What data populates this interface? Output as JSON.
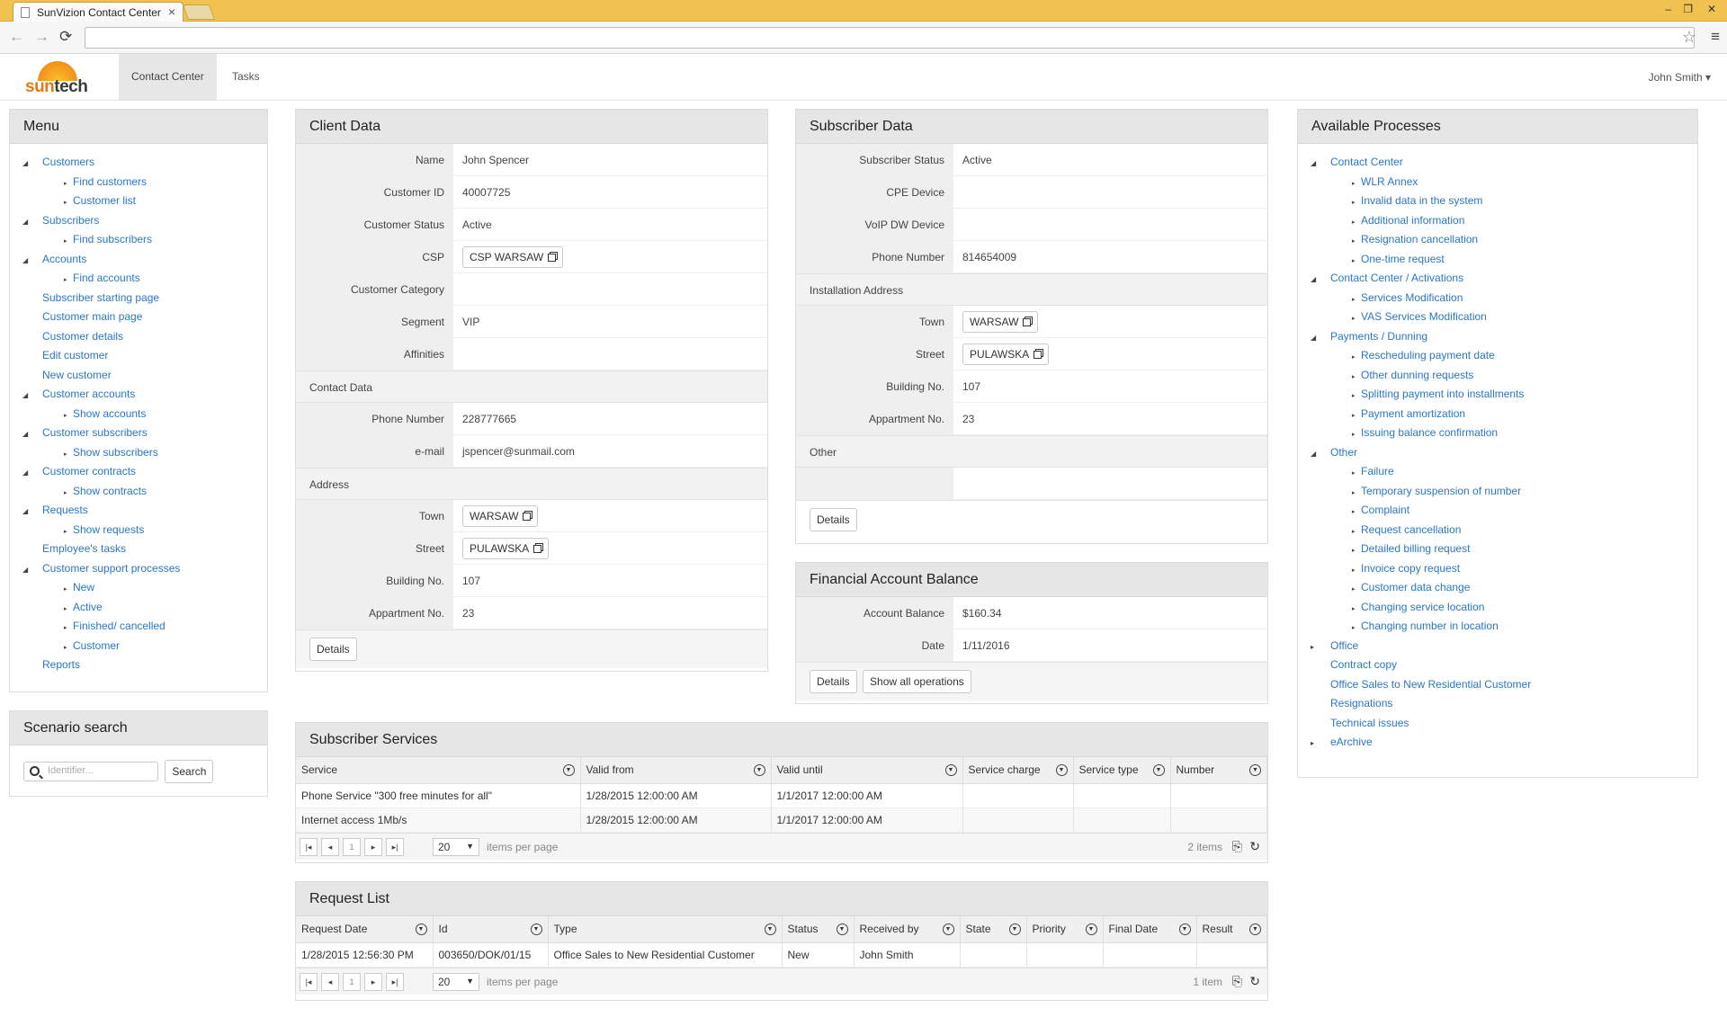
{
  "browser": {
    "tab_title": "SunVizion Contact Center",
    "tab_close": "×",
    "win_min": "–",
    "win_max": "❐",
    "win_close": "✕",
    "back": "←",
    "forward": "→",
    "reload": "⟳",
    "star": "☆",
    "menu": "≡"
  },
  "app": {
    "logo_sun": "sun",
    "logo_tech": "tech",
    "tabs": [
      "Contact Center",
      "Tasks"
    ],
    "user": "John Smith ▾"
  },
  "menu": {
    "title": "Menu",
    "items": [
      {
        "level": 1,
        "label": "Customers",
        "arrow": "◢"
      },
      {
        "level": 2,
        "label": "Find customers"
      },
      {
        "level": 2,
        "label": "Customer list"
      },
      {
        "level": 1,
        "label": "Subscribers",
        "arrow": "◢"
      },
      {
        "level": 2,
        "label": "Find subscribers"
      },
      {
        "level": 1,
        "label": "Accounts",
        "arrow": "◢"
      },
      {
        "level": 2,
        "label": "Find accounts"
      },
      {
        "level": 1,
        "label": "Subscriber starting page"
      },
      {
        "level": 1,
        "label": "Customer main page"
      },
      {
        "level": 1,
        "label": "Customer details"
      },
      {
        "level": 1,
        "label": "Edit customer"
      },
      {
        "level": 1,
        "label": "New customer"
      },
      {
        "level": 1,
        "label": "Customer accounts",
        "arrow": "◢"
      },
      {
        "level": 2,
        "label": "Show accounts"
      },
      {
        "level": 1,
        "label": "Customer subscribers",
        "arrow": "◢"
      },
      {
        "level": 2,
        "label": "Show subscribers"
      },
      {
        "level": 1,
        "label": "Customer contracts",
        "arrow": "◢"
      },
      {
        "level": 2,
        "label": "Show contracts"
      },
      {
        "level": 1,
        "label": "Requests",
        "arrow": "◢"
      },
      {
        "level": 2,
        "label": "Show requests"
      },
      {
        "level": 1,
        "label": "Employee's tasks"
      },
      {
        "level": 1,
        "label": "Customer support processes",
        "arrow": "◢"
      },
      {
        "level": 2,
        "label": "New"
      },
      {
        "level": 2,
        "label": "Active"
      },
      {
        "level": 2,
        "label": "Finished/ cancelled"
      },
      {
        "level": 2,
        "label": "Customer"
      },
      {
        "level": 1,
        "label": "Reports"
      }
    ]
  },
  "scenario": {
    "title": "Scenario search",
    "placeholder": "Identifier...",
    "button": "Search"
  },
  "client": {
    "title": "Client Data",
    "rows": [
      {
        "label": "Name",
        "value": "John Spencer"
      },
      {
        "label": "Customer ID",
        "value": "40007725"
      },
      {
        "label": "Customer Status",
        "value": "Active"
      },
      {
        "label": "CSP",
        "chip": "CSP WARSAW"
      },
      {
        "label": "Customer Category",
        "value": ""
      },
      {
        "label": "Segment",
        "value": "VIP"
      },
      {
        "label": "Affinities",
        "value": ""
      }
    ],
    "contact_title": "Contact Data",
    "contact_rows": [
      {
        "label": "Phone Number",
        "value": "228777665"
      },
      {
        "label": "e-mail",
        "value": "jspencer@sunmail.com"
      }
    ],
    "address_title": "Address",
    "address_rows": [
      {
        "label": "Town",
        "chip": "WARSAW"
      },
      {
        "label": "Street",
        "chip": "PULAWSKA"
      },
      {
        "label": "Building No.",
        "value": "107"
      },
      {
        "label": "Appartment No.",
        "value": "23"
      }
    ],
    "details": "Details"
  },
  "subscriber": {
    "title": "Subscriber Data",
    "rows": [
      {
        "label": "Subscriber Status",
        "value": "Active"
      },
      {
        "label": "CPE Device",
        "value": ""
      },
      {
        "label": "VoIP DW Device",
        "value": ""
      },
      {
        "label": "Phone Number",
        "value": "814654009"
      }
    ],
    "install_title": "Installation Address",
    "install_rows": [
      {
        "label": "Town",
        "chip": "WARSAW"
      },
      {
        "label": "Street",
        "chip": "PULAWSKA"
      },
      {
        "label": "Building No.",
        "value": "107"
      },
      {
        "label": "Appartment No.",
        "value": "23"
      }
    ],
    "other_title": "Other",
    "details": "Details"
  },
  "financial": {
    "title": "Financial Account Balance",
    "rows": [
      {
        "label": "Account Balance",
        "value": "$160.34"
      },
      {
        "label": "Date",
        "value": "1/11/2016"
      }
    ],
    "details": "Details",
    "show_all": "Show all operations"
  },
  "processes": {
    "title": "Available Processes",
    "items": [
      {
        "level": 1,
        "label": "Contact Center",
        "arrow": "◢"
      },
      {
        "level": 2,
        "label": "WLR Annex"
      },
      {
        "level": 2,
        "label": "Invalid data in the system"
      },
      {
        "level": 2,
        "label": "Additional information"
      },
      {
        "level": 2,
        "label": "Resignation cancellation"
      },
      {
        "level": 2,
        "label": "One-time request"
      },
      {
        "level": 1,
        "label": "Contact Center / Activations",
        "arrow": "◢"
      },
      {
        "level": 2,
        "label": "Services Modification"
      },
      {
        "level": 2,
        "label": "VAS Services Modification"
      },
      {
        "level": 1,
        "label": "Payments / Dunning",
        "arrow": "◢"
      },
      {
        "level": 2,
        "label": "Rescheduling payment date"
      },
      {
        "level": 2,
        "label": "Other dunning requests"
      },
      {
        "level": 2,
        "label": "Splitting payment into installments"
      },
      {
        "level": 2,
        "label": "Payment amortization"
      },
      {
        "level": 2,
        "label": "Issuing balance confirmation"
      },
      {
        "level": 1,
        "label": "Other",
        "arrow": "◢"
      },
      {
        "level": 2,
        "label": "Failure"
      },
      {
        "level": 2,
        "label": "Temporary suspension of number"
      },
      {
        "level": 2,
        "label": "Complaint"
      },
      {
        "level": 2,
        "label": "Request cancellation"
      },
      {
        "level": 2,
        "label": "Detailed billing request"
      },
      {
        "level": 2,
        "label": "Invoice copy request"
      },
      {
        "level": 2,
        "label": "Customer data change"
      },
      {
        "level": 2,
        "label": "Changing service location"
      },
      {
        "level": 2,
        "label": "Changing number in location"
      },
      {
        "level": 1,
        "label": "Office",
        "arrow": "▸"
      },
      {
        "level": 1,
        "label": "Contract copy"
      },
      {
        "level": 1,
        "label": "Office Sales to New Residential Customer"
      },
      {
        "level": 1,
        "label": "Resignations"
      },
      {
        "level": 1,
        "label": "Technical issues"
      },
      {
        "level": 1,
        "label": "eArchive",
        "arrow": "▸"
      }
    ]
  },
  "services": {
    "title": "Subscriber Services",
    "columns": [
      "Service",
      "Valid from",
      "Valid until",
      "Service charge",
      "Service type",
      "Number"
    ],
    "rows": [
      [
        "Phone Service \"300 free minutes for all\"",
        "1/28/2015 12:00:00 AM",
        "1/1/2017 12:00:00 AM",
        "",
        "",
        ""
      ],
      [
        "Internet access 1Mb/s",
        "1/28/2015 12:00:00 AM",
        "1/1/2017 12:00:00 AM",
        "",
        "",
        ""
      ]
    ],
    "page": "1",
    "page_size": "20",
    "items_per_page": "items per page",
    "count": "2 items"
  },
  "requests": {
    "title": "Request List",
    "columns": [
      "Request Date",
      "Id",
      "Type",
      "Status",
      "Received by",
      "State",
      "Priority",
      "Final Date",
      "Result"
    ],
    "rows": [
      [
        "1/28/2015 12:56:30 PM",
        "003650/DOK/01/15",
        "Office Sales to New Residential Customer",
        "New",
        "John Smith",
        "",
        "",
        "",
        ""
      ]
    ],
    "page": "1",
    "page_size": "20",
    "items_per_page": "items per page",
    "count": "1 item"
  }
}
